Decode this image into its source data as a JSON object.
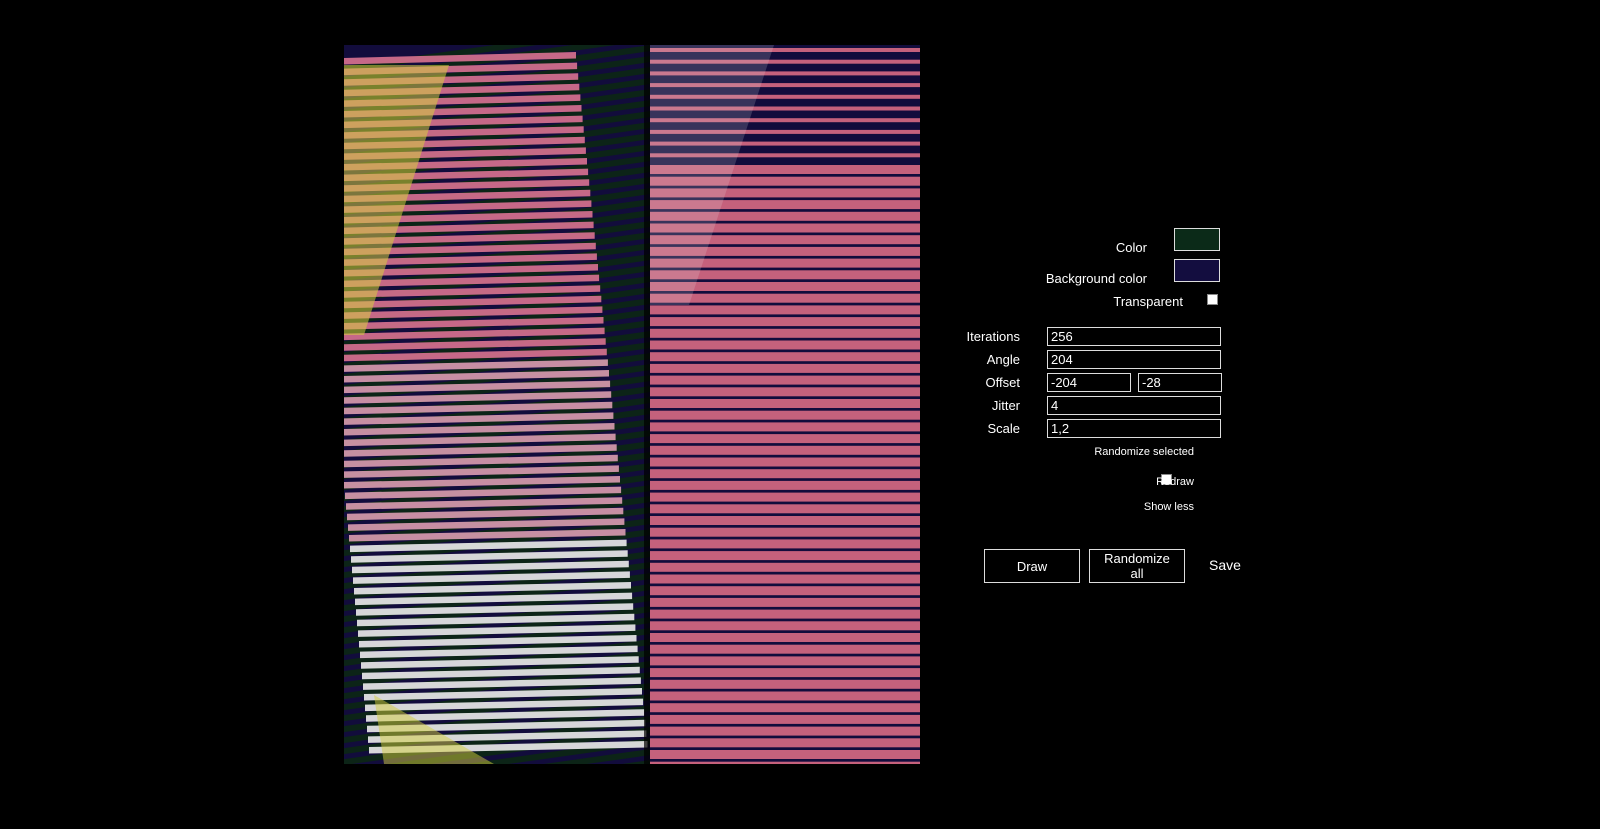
{
  "artwork": {
    "stripe_color": "#0d2a18",
    "background_color": "#120c3c",
    "palette": [
      "#d4ce3e",
      "#d6718f",
      "#c5617c",
      "#e8e8e8",
      "#0c2417",
      "#120c3c"
    ]
  },
  "controls": {
    "color_label": "Color",
    "color_value": "#0b2a18",
    "background_color_label": "Background color",
    "background_color_value": "#130d3f",
    "transparent_label": "Transparent",
    "transparent_checked": false,
    "iterations_label": "Iterations",
    "iterations_value": "256",
    "angle_label": "Angle",
    "angle_value": "204",
    "offset_label": "Offset",
    "offset_x_value": "-204",
    "offset_y_value": "-28",
    "jitter_label": "Jitter",
    "jitter_value": "4",
    "scale_label": "Scale",
    "scale_value": "1,2",
    "randomize_selected_label": "Randomize selected",
    "redraw_label": "Redraw",
    "redraw_checked": false,
    "show_less_label": "Show less"
  },
  "buttons": {
    "draw_label": "Draw",
    "randomize_all_label": "Randomize all",
    "save_label": "Save"
  }
}
